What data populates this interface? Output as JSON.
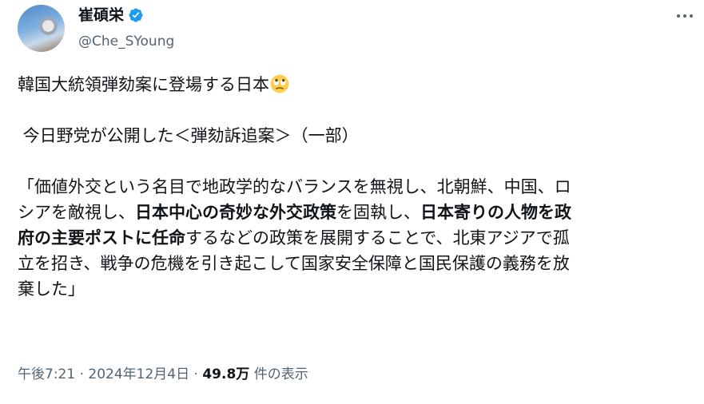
{
  "author": {
    "display_name": "崔碩栄",
    "handle": "@Che_SYoung",
    "verified": true
  },
  "menu": {
    "icon": "more-horizontal-icon"
  },
  "tweet": {
    "title_line": "韓国大統領弾劾案に登場する日本",
    "title_emoji": "face-with-rolling-eyes",
    "subtitle_line": " 今日野党が公開した＜弾劾訴追案＞（一部）",
    "quote_line1": "「価値外交という名目で地政学的なバランスを無視し、北朝鮮、中国、ロ",
    "quote_line2_a": "シアを敵視し、",
    "quote_line2_bold1": "日本中心の奇妙な外交政策",
    "quote_line2_b": "を固執し、",
    "quote_line2_bold2": "日本寄りの人物を政",
    "quote_line3_bold": "府の主要ポストに任命",
    "quote_line3_rest": "するなどの政策を展開することで、北東アジアで孤",
    "quote_line4": "立を招き、戦争の危機を引き起こして国家安全保障と国民保護の義務を放",
    "quote_line5": "棄した」"
  },
  "meta": {
    "time": "午後7:21",
    "separator1": " · ",
    "date": "2024年12月4日",
    "separator2": " · ",
    "views_count": "49.8万",
    "views_label": " 件の表示"
  },
  "colors": {
    "text": "#0f1419",
    "secondary": "#536471",
    "verified_badge": "#1d9bf0"
  }
}
